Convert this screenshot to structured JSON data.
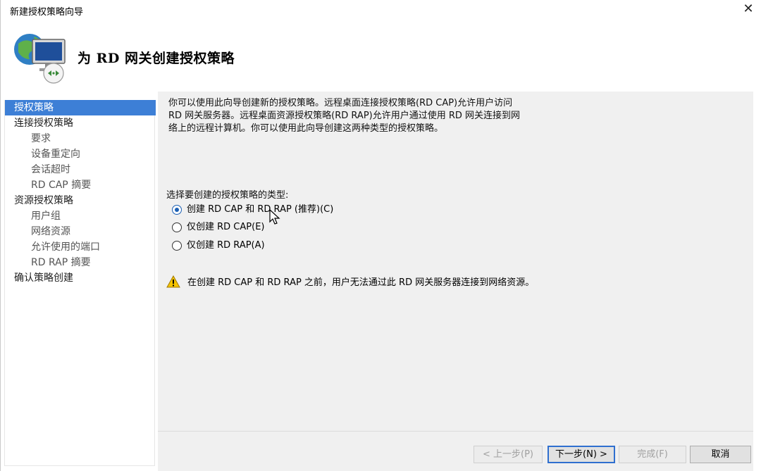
{
  "window": {
    "title": "新建授权策略向导",
    "close_glyph": "✕"
  },
  "header": {
    "heading": "为 RD 网关创建授权策略",
    "icon": "network-computer-remote-icon"
  },
  "nav": {
    "items": [
      {
        "label": "授权策略",
        "level": 1,
        "active": true
      },
      {
        "label": "连接授权策略",
        "level": 1,
        "active": false
      },
      {
        "label": "要求",
        "level": 2,
        "active": false
      },
      {
        "label": "设备重定向",
        "level": 2,
        "active": false
      },
      {
        "label": "会话超时",
        "level": 2,
        "active": false
      },
      {
        "label": "RD CAP 摘要",
        "level": 2,
        "active": false
      },
      {
        "label": "资源授权策略",
        "level": 1,
        "active": false
      },
      {
        "label": "用户组",
        "level": 2,
        "active": false
      },
      {
        "label": "网络资源",
        "level": 2,
        "active": false
      },
      {
        "label": "允许使用的端口",
        "level": 2,
        "active": false
      },
      {
        "label": "RD RAP 摘要",
        "level": 2,
        "active": false
      },
      {
        "label": "确认策略创建",
        "level": 1,
        "active": false
      }
    ]
  },
  "content": {
    "intro_lines": [
      "你可以使用此向导创建新的授权策略。远程桌面连接授权策略(RD CAP)允许用户访问",
      "RD 网关服务器。远程桌面资源授权策略(RD RAP)允许用户通过使用 RD 网关连接到网",
      "络上的远程计算机。你可以使用此向导创建这两种类型的授权策略。"
    ],
    "prompt": "选择要创建的授权策略的类型:",
    "options": [
      {
        "label": "创建 RD CAP 和 RD RAP (推荐)(C)",
        "checked": true
      },
      {
        "label": "仅创建 RD CAP(E)",
        "checked": false
      },
      {
        "label": "仅创建 RD RAP(A)",
        "checked": false
      }
    ],
    "warning": "在创建 RD CAP 和 RD RAP 之前，用户无法通过此 RD 网关服务器连接到网络资源。"
  },
  "footer": {
    "back_label": "< 上一步(P)",
    "next_label": "下一步(N) >",
    "finish_label": "完成(F)",
    "cancel_label": "取消"
  },
  "colors": {
    "nav_active": "#3d7fd6",
    "content_bg": "#f0f0f0",
    "primary_border": "#2f6fcf"
  }
}
